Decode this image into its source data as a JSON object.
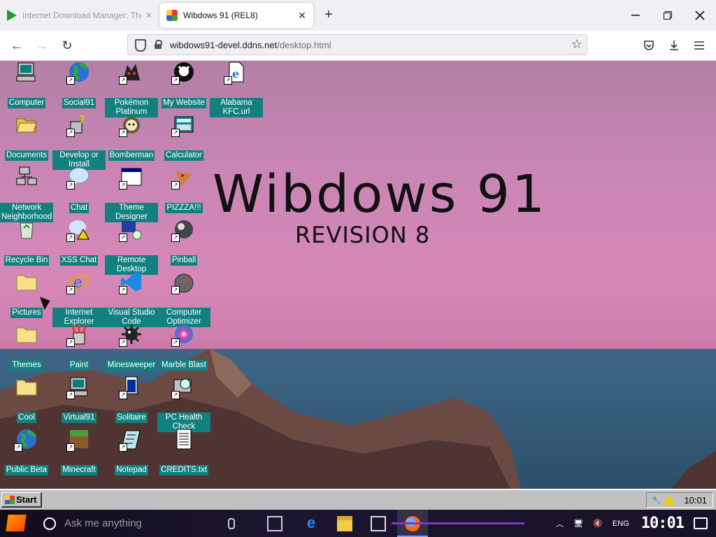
{
  "browser": {
    "inactive_tab_title": "Internet Download Manager: The f...",
    "active_tab_title": "Wibdows 91 (REL8)",
    "url_domain": "wibdows91-devel.ddns.net",
    "url_path": "/desktop.html"
  },
  "desktop": {
    "title": "Wibdows 91",
    "subtitle": "REVISION 8",
    "icons": [
      {
        "label": "Computer",
        "icon": "computer-icon"
      },
      {
        "label": "Social91",
        "icon": "globe-icon"
      },
      {
        "label": "Pokémon Platinum",
        "icon": "pokemon-icon"
      },
      {
        "label": "My Website",
        "icon": "github-icon"
      },
      {
        "label": "Alabama KFC.url",
        "icon": "internet-shortcut-icon"
      },
      {
        "label": "Documents",
        "icon": "folder-open-icon"
      },
      {
        "label": "Develop or Install",
        "icon": "help-setup-icon"
      },
      {
        "label": "Bomberman",
        "icon": "bomberman-icon"
      },
      {
        "label": "Calculator",
        "icon": "calculator-icon"
      },
      {
        "label": "Network Neighborhood",
        "icon": "network-icon"
      },
      {
        "label": "Chat",
        "icon": "chat-bubble-icon"
      },
      {
        "label": "Theme Designer",
        "icon": "window-icon"
      },
      {
        "label": "PIZZZA!!!",
        "icon": "pizza-icon"
      },
      {
        "label": "Recycle Bin",
        "icon": "recycle-bin-icon"
      },
      {
        "label": "XSS Chat",
        "icon": "warning-chat-icon"
      },
      {
        "label": "Remote Desktop",
        "icon": "remote-desktop-icon"
      },
      {
        "label": "Pinball",
        "icon": "pinball-icon"
      },
      {
        "label": "Pictures",
        "icon": "folder-icon"
      },
      {
        "label": "Internet Explorer",
        "icon": "ie-icon"
      },
      {
        "label": "Visual Studio Code",
        "icon": "vscode-icon"
      },
      {
        "label": "Computer Optimizer",
        "icon": "gauge-icon"
      },
      {
        "label": "Themes",
        "icon": "folder-icon"
      },
      {
        "label": "Paint",
        "icon": "paint-icon"
      },
      {
        "label": "Minesweeper",
        "icon": "mine-icon"
      },
      {
        "label": "Marble Blast",
        "icon": "marble-icon"
      },
      {
        "label": "Cool",
        "icon": "folder-icon"
      },
      {
        "label": "Virtual91",
        "icon": "computer-icon"
      },
      {
        "label": "Solitaire",
        "icon": "solitaire-icon"
      },
      {
        "label": "PC Health Check",
        "icon": "health-check-icon"
      },
      {
        "label": "Public Beta",
        "icon": "globe-icon"
      },
      {
        "label": "Minecraft",
        "icon": "minecraft-icon"
      },
      {
        "label": "Notepad",
        "icon": "notepad-icon"
      },
      {
        "label": "CREDITS.txt",
        "icon": "text-file-icon"
      }
    ]
  },
  "w91_taskbar": {
    "start_label": "Start",
    "clock": "10:01"
  },
  "w10_taskbar": {
    "search_placeholder": "Ask me anything",
    "lang": "ENG",
    "clock": "10:01"
  }
}
